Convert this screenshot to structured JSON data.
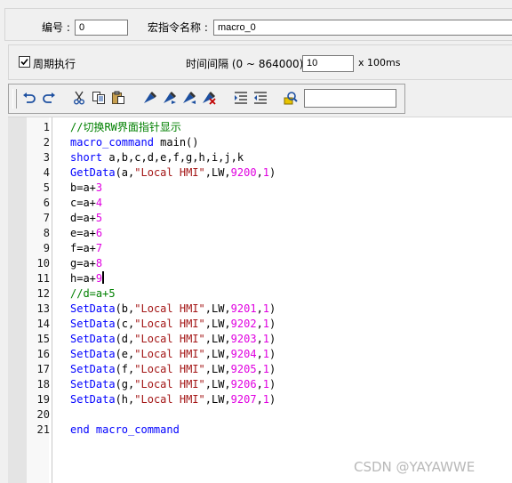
{
  "header": {
    "id_label": "编号 :",
    "id_value": "0",
    "macro_name_label": "宏指令名称 :",
    "macro_name_value": "macro_0"
  },
  "options": {
    "periodic_label": "周期执行",
    "periodic_checked": true,
    "interval_label": "时间间隔 (0 ~ 864000) :",
    "interval_value": "10",
    "interval_unit": "x 100ms"
  },
  "toolbar": {
    "buttons": [
      "undo-icon",
      "redo-icon",
      "cut-icon",
      "copy-icon",
      "paste-icon",
      "toggle-bookmark-icon",
      "next-bookmark-icon",
      "prev-bookmark-icon",
      "clear-bookmarks-icon",
      "indent-icon",
      "outdent-icon",
      "find-icon"
    ],
    "search_value": ""
  },
  "editor": {
    "lines": [
      {
        "n": "1",
        "tokens": [
          {
            "t": "//切换RW界面指针显示",
            "c": "comment"
          }
        ]
      },
      {
        "n": "2",
        "tokens": [
          {
            "t": "macro_command",
            "c": "kw"
          },
          {
            "t": " main()",
            "c": "plain"
          }
        ]
      },
      {
        "n": "3",
        "tokens": [
          {
            "t": "short",
            "c": "kw"
          },
          {
            "t": " a,b,c,d,e,f,g,h,i,j,k",
            "c": "plain"
          }
        ]
      },
      {
        "n": "4",
        "tokens": [
          {
            "t": "GetData",
            "c": "kw"
          },
          {
            "t": "(a,",
            "c": "plain"
          },
          {
            "t": "\"Local HMI\"",
            "c": "str"
          },
          {
            "t": ",LW,",
            "c": "plain"
          },
          {
            "t": "9200",
            "c": "num"
          },
          {
            "t": ",",
            "c": "plain"
          },
          {
            "t": "1",
            "c": "num"
          },
          {
            "t": ")",
            "c": "plain"
          }
        ]
      },
      {
        "n": "5",
        "tokens": [
          {
            "t": "b=a+",
            "c": "plain"
          },
          {
            "t": "3",
            "c": "num"
          }
        ]
      },
      {
        "n": "6",
        "tokens": [
          {
            "t": "c=a+",
            "c": "plain"
          },
          {
            "t": "4",
            "c": "num"
          }
        ]
      },
      {
        "n": "7",
        "tokens": [
          {
            "t": "d=a+",
            "c": "plain"
          },
          {
            "t": "5",
            "c": "num"
          }
        ]
      },
      {
        "n": "8",
        "tokens": [
          {
            "t": "e=a+",
            "c": "plain"
          },
          {
            "t": "6",
            "c": "num"
          }
        ]
      },
      {
        "n": "9",
        "tokens": [
          {
            "t": "f=a+",
            "c": "plain"
          },
          {
            "t": "7",
            "c": "num"
          }
        ]
      },
      {
        "n": "10",
        "tokens": [
          {
            "t": "g=a+",
            "c": "plain"
          },
          {
            "t": "8",
            "c": "num"
          }
        ]
      },
      {
        "n": "11",
        "tokens": [
          {
            "t": "h=a+",
            "c": "plain"
          },
          {
            "t": "9",
            "c": "num"
          }
        ],
        "cursor": true
      },
      {
        "n": "12",
        "tokens": [
          {
            "t": "//d=a+5",
            "c": "comment"
          }
        ]
      },
      {
        "n": "13",
        "tokens": [
          {
            "t": "SetData",
            "c": "kw"
          },
          {
            "t": "(b,",
            "c": "plain"
          },
          {
            "t": "\"Local HMI\"",
            "c": "str"
          },
          {
            "t": ",LW,",
            "c": "plain"
          },
          {
            "t": "9201",
            "c": "num"
          },
          {
            "t": ",",
            "c": "plain"
          },
          {
            "t": "1",
            "c": "num"
          },
          {
            "t": ")",
            "c": "plain"
          }
        ]
      },
      {
        "n": "14",
        "tokens": [
          {
            "t": "SetData",
            "c": "kw"
          },
          {
            "t": "(c,",
            "c": "plain"
          },
          {
            "t": "\"Local HMI\"",
            "c": "str"
          },
          {
            "t": ",LW,",
            "c": "plain"
          },
          {
            "t": "9202",
            "c": "num"
          },
          {
            "t": ",",
            "c": "plain"
          },
          {
            "t": "1",
            "c": "num"
          },
          {
            "t": ")",
            "c": "plain"
          }
        ]
      },
      {
        "n": "15",
        "tokens": [
          {
            "t": "SetData",
            "c": "kw"
          },
          {
            "t": "(d,",
            "c": "plain"
          },
          {
            "t": "\"Local HMI\"",
            "c": "str"
          },
          {
            "t": ",LW,",
            "c": "plain"
          },
          {
            "t": "9203",
            "c": "num"
          },
          {
            "t": ",",
            "c": "plain"
          },
          {
            "t": "1",
            "c": "num"
          },
          {
            "t": ")",
            "c": "plain"
          }
        ]
      },
      {
        "n": "16",
        "tokens": [
          {
            "t": "SetData",
            "c": "kw"
          },
          {
            "t": "(e,",
            "c": "plain"
          },
          {
            "t": "\"Local HMI\"",
            "c": "str"
          },
          {
            "t": ",LW,",
            "c": "plain"
          },
          {
            "t": "9204",
            "c": "num"
          },
          {
            "t": ",",
            "c": "plain"
          },
          {
            "t": "1",
            "c": "num"
          },
          {
            "t": ")",
            "c": "plain"
          }
        ]
      },
      {
        "n": "17",
        "tokens": [
          {
            "t": "SetData",
            "c": "kw"
          },
          {
            "t": "(f,",
            "c": "plain"
          },
          {
            "t": "\"Local HMI\"",
            "c": "str"
          },
          {
            "t": ",LW,",
            "c": "plain"
          },
          {
            "t": "9205",
            "c": "num"
          },
          {
            "t": ",",
            "c": "plain"
          },
          {
            "t": "1",
            "c": "num"
          },
          {
            "t": ")",
            "c": "plain"
          }
        ]
      },
      {
        "n": "18",
        "tokens": [
          {
            "t": "SetData",
            "c": "kw"
          },
          {
            "t": "(g,",
            "c": "plain"
          },
          {
            "t": "\"Local HMI\"",
            "c": "str"
          },
          {
            "t": ",LW,",
            "c": "plain"
          },
          {
            "t": "9206",
            "c": "num"
          },
          {
            "t": ",",
            "c": "plain"
          },
          {
            "t": "1",
            "c": "num"
          },
          {
            "t": ")",
            "c": "plain"
          }
        ]
      },
      {
        "n": "19",
        "tokens": [
          {
            "t": "SetData",
            "c": "kw"
          },
          {
            "t": "(h,",
            "c": "plain"
          },
          {
            "t": "\"Local HMI\"",
            "c": "str"
          },
          {
            "t": ",LW,",
            "c": "plain"
          },
          {
            "t": "9207",
            "c": "num"
          },
          {
            "t": ",",
            "c": "plain"
          },
          {
            "t": "1",
            "c": "num"
          },
          {
            "t": ")",
            "c": "plain"
          }
        ]
      },
      {
        "n": "20",
        "tokens": []
      },
      {
        "n": "21",
        "tokens": [
          {
            "t": "end macro_command",
            "c": "kw"
          }
        ]
      }
    ]
  },
  "watermark": "CSDN @YAYAWWE",
  "colors": {
    "keyword": "#0000ff",
    "comment": "#008000",
    "string": "#a31515",
    "number": "#e000e0"
  }
}
